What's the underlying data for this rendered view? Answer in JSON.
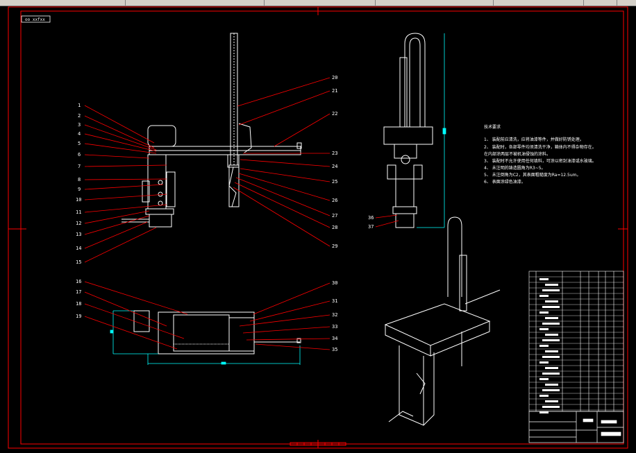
{
  "window": {
    "title_tag": "oo xxfxx"
  },
  "callouts": {
    "left_view": [
      "1",
      "2",
      "3",
      "4",
      "5",
      "6",
      "7",
      "8",
      "9",
      "10",
      "11",
      "12",
      "13",
      "14",
      "15"
    ],
    "right_view": [
      "20",
      "21",
      "22",
      "23",
      "24",
      "25",
      "26",
      "27",
      "28",
      "29"
    ],
    "bottom_left": [
      "16",
      "17",
      "18",
      "19"
    ],
    "bottom_right": [
      "30",
      "31",
      "32",
      "33",
      "34",
      "35"
    ],
    "side_view": [
      "36",
      "37"
    ]
  },
  "technical_notes": {
    "heading": "技术要求",
    "lines": [
      "1、 装配前应清洗，应将油漆等件，并做好防锈处理。",
      "2、 装配时，各部零件均须清洗干净，箱体内不得杂物存在。",
      "   在内部涂两层不被机油侵蚀的涂料。",
      "3、 装配时不允许使用任何填料，可涂以密封油漆或水玻璃。",
      "4、 未注明的铸造圆角为R3~5。",
      "5、 未注倒角为C2，其表面粗糙度为Ra=12.5um。",
      "6、 表面涂绿色油漆。"
    ]
  },
  "colors": {
    "frame": "#ff0000",
    "leader": "#ff0000",
    "drawing": "#ffffff",
    "dimension": "#00ffff",
    "background": "#000000"
  }
}
